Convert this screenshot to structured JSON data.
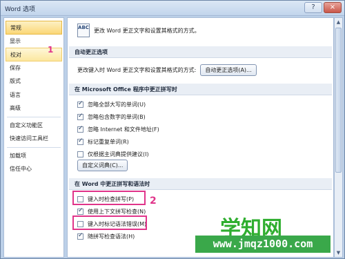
{
  "window": {
    "title": "Word 选项",
    "minimize": "?",
    "close": "×"
  },
  "sidebar": {
    "items": [
      {
        "label": "常规"
      },
      {
        "label": "显示"
      },
      {
        "label": "校对"
      },
      {
        "label": "保存"
      },
      {
        "label": "版式"
      },
      {
        "label": "语言"
      },
      {
        "label": "高级"
      },
      {
        "label": "自定义功能区"
      },
      {
        "label": "快速访问工具栏"
      },
      {
        "label": "加载项"
      },
      {
        "label": "信任中心"
      }
    ]
  },
  "intro": {
    "icon_text": "ABC",
    "text": "更改 Word 更正文字和设置其格式的方式。"
  },
  "autocorrect": {
    "header": "自动更正选项",
    "desc": "更改键入时 Word 更正文字和设置其格式的方式:",
    "button": "自动更正选项(A)..."
  },
  "office": {
    "header": "在 Microsoft Office 程序中更正拼写时",
    "options": [
      {
        "label": "忽略全部大写的单词(U)",
        "checked": true
      },
      {
        "label": "忽略包含数字的单词(B)",
        "checked": true
      },
      {
        "label": "忽略 Internet 和文件地址(F)",
        "checked": true
      },
      {
        "label": "标记重复单词(R)",
        "checked": true
      },
      {
        "label": "仅根据主词典提供建议(I)",
        "checked": false
      }
    ],
    "dict_button": "自定义词典(C)..."
  },
  "word": {
    "header": "在 Word 中更正拼写和语法时",
    "options": [
      {
        "label": "键入时检查拼写(P)",
        "checked": false
      },
      {
        "label": "使用上下文拼写检查(N)",
        "checked": true
      },
      {
        "label": "键入时标记语法错误(M)",
        "checked": false
      },
      {
        "label": "随拼写检查语法(H)",
        "checked": true
      }
    ]
  },
  "annotations": {
    "n1": "1",
    "n2": "2"
  },
  "watermark": {
    "title": "学知网",
    "url": "www.jmqz1000.com"
  },
  "colors": {
    "highlight": "#e0348a",
    "watermark": "#2fae2f"
  }
}
